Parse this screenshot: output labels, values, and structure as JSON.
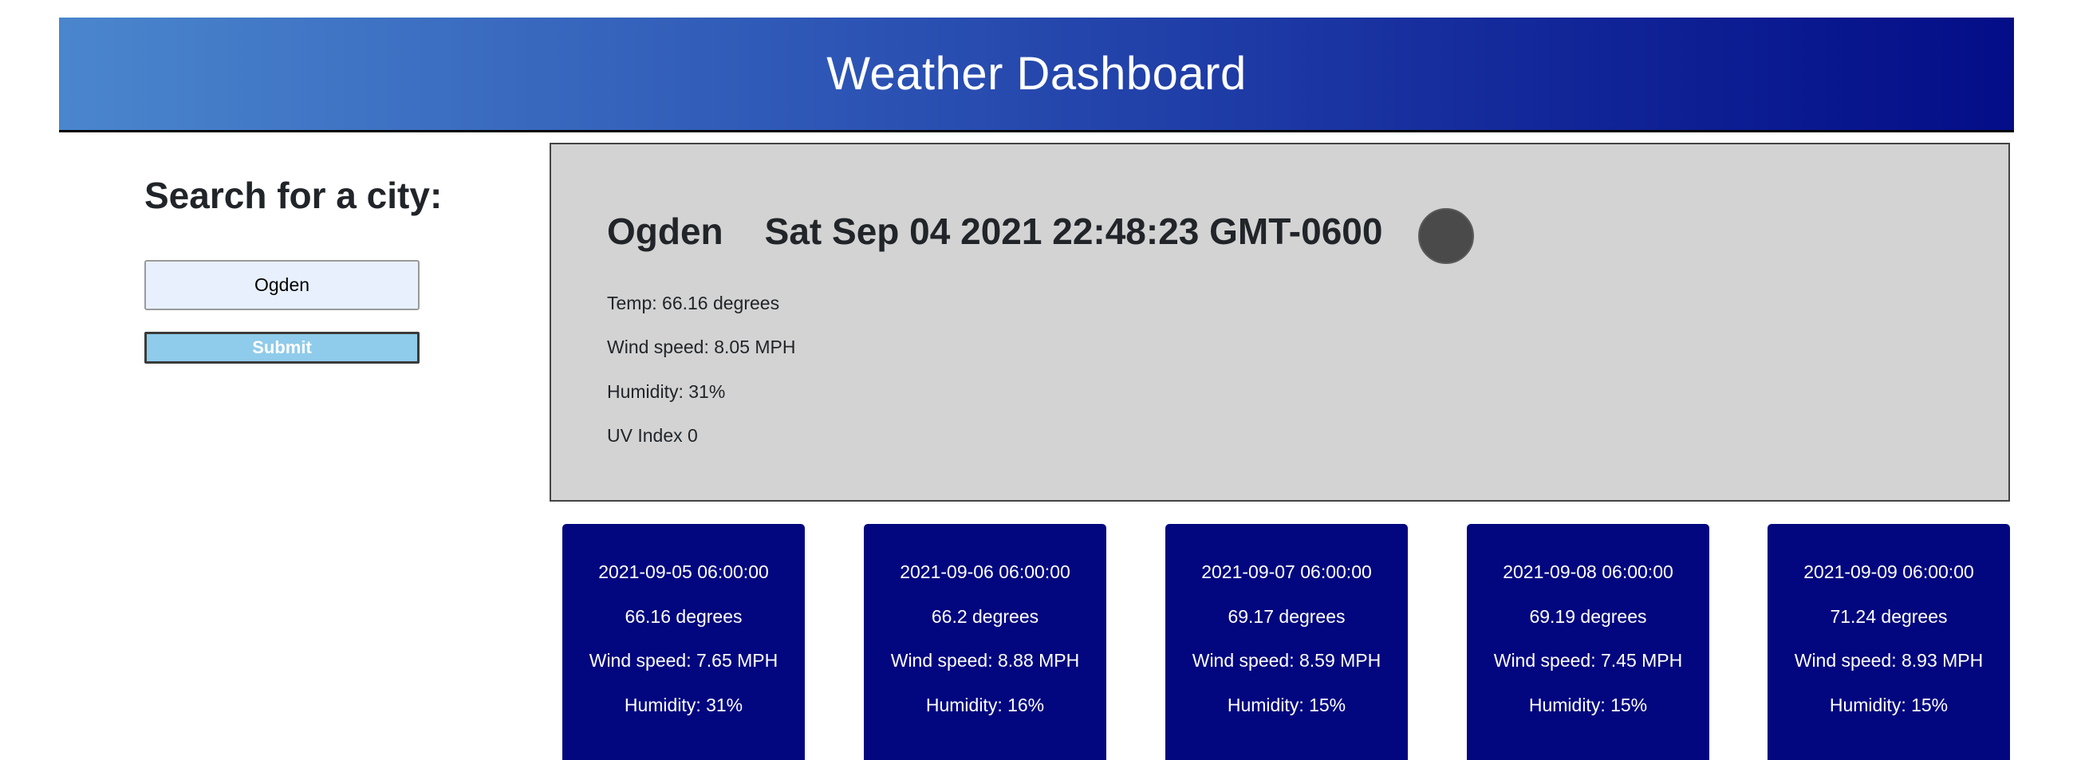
{
  "header": {
    "title": "Weather Dashboard"
  },
  "search": {
    "heading": "Search for a city:",
    "input_value": "Ogden",
    "submit_label": "Submit"
  },
  "current": {
    "city": "Ogden",
    "datetime": "Sat Sep 04 2021 22:48:23 GMT-0600",
    "icon": "weather-icon",
    "temp": "Temp: 66.16 degrees",
    "wind": "Wind speed: 8.05 MPH",
    "humidity": "Humidity: 31%",
    "uv": "UV Index 0"
  },
  "forecast": [
    {
      "date": "2021-09-05 06:00:00",
      "temp": "66.16 degrees",
      "wind": "Wind speed: 7.65 MPH",
      "humidity": "Humidity: 31%"
    },
    {
      "date": "2021-09-06 06:00:00",
      "temp": "66.2 degrees",
      "wind": "Wind speed: 8.88 MPH",
      "humidity": "Humidity: 16%"
    },
    {
      "date": "2021-09-07 06:00:00",
      "temp": "69.17 degrees",
      "wind": "Wind speed: 8.59 MPH",
      "humidity": "Humidity: 15%"
    },
    {
      "date": "2021-09-08 06:00:00",
      "temp": "69.19 degrees",
      "wind": "Wind speed: 7.45 MPH",
      "humidity": "Humidity: 15%"
    },
    {
      "date": "2021-09-09 06:00:00",
      "temp": "71.24 degrees",
      "wind": "Wind speed: 8.93 MPH",
      "humidity": "Humidity: 15%"
    }
  ],
  "colors": {
    "header_gradient_start": "#4a86cd",
    "header_gradient_end": "#030d87",
    "panel_bg": "#d3d3d3",
    "card_bg": "#02077f",
    "submit_bg": "#8fcbea",
    "input_bg": "#e8f0fe"
  }
}
